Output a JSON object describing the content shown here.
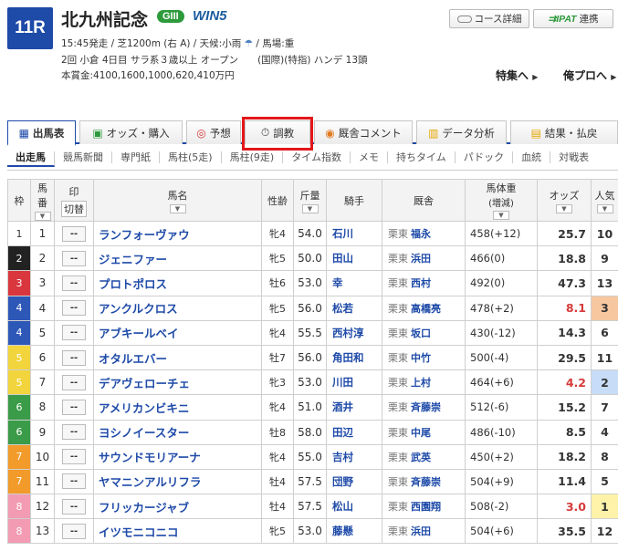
{
  "race": {
    "number": "11R",
    "title": "北九州記念",
    "grade": "GIII",
    "win5": "WIN5",
    "info_line1_pre": "15:45発走 / 芝1200m (右 A) / 天候:小雨",
    "info_line1_post": "/ 馬場:重",
    "info_line2": "2回 小倉 4日目 サラ系３歳以上 オープン　　(国際)(特指) ハンデ 13頭",
    "info_line3": "本賞金:4100,1600,1000,620,410万円",
    "weather_icon": "umbrella-icon"
  },
  "header_buttons": {
    "course": "コース詳細",
    "ipat_logo": "IPAT",
    "ipat_label": "連携",
    "special": "特集へ",
    "ore_pro": "俺プロへ"
  },
  "tabs": [
    {
      "label": "出馬表",
      "icon": "table-icon"
    },
    {
      "label": "オッズ・購入",
      "icon": "odds-icon"
    },
    {
      "label": "予想",
      "icon": "target-icon"
    },
    {
      "label": "調教",
      "icon": "stopwatch-icon"
    },
    {
      "label": "厩舎コメント",
      "icon": "comment-icon"
    },
    {
      "label": "データ分析",
      "icon": "chart-icon"
    },
    {
      "label": "結果・払戻",
      "icon": "result-icon"
    }
  ],
  "subtabs": [
    "出走馬",
    "競馬新聞",
    "専門紙",
    "馬柱(5走)",
    "馬柱(9走)",
    "タイム指数",
    "メモ",
    "持ちタイム",
    "パドック",
    "血統",
    "対戦表"
  ],
  "columns": {
    "waku": "枠",
    "umaban_1": "馬",
    "umaban_2": "番",
    "mark_1": "印",
    "mark_2": "切替",
    "name": "馬名",
    "sex": "性齢",
    "kin": "斤量",
    "jockey": "騎手",
    "stable": "厩舎",
    "weight_1": "馬体重",
    "weight_2": "(増減)",
    "odds": "オッズ",
    "pop": "人気"
  },
  "horses": [
    {
      "waku": "1",
      "num": "1",
      "mark": "--",
      "name": "ランフォーヴァウ",
      "sex": "牝4",
      "kin": "54.0",
      "jockey": "石川",
      "region": "栗東",
      "trainer": "福永",
      "weight": "458(+12)",
      "odds": "25.7",
      "pop": "10"
    },
    {
      "waku": "2",
      "num": "2",
      "mark": "--",
      "name": "ジェニファー",
      "sex": "牝5",
      "kin": "50.0",
      "jockey": "田山",
      "region": "栗東",
      "trainer": "浜田",
      "weight": "466(0)",
      "odds": "18.8",
      "pop": "9"
    },
    {
      "waku": "3",
      "num": "3",
      "mark": "--",
      "name": "プロトポロス",
      "sex": "牡6",
      "kin": "53.0",
      "jockey": "幸",
      "region": "栗東",
      "trainer": "西村",
      "weight": "492(0)",
      "odds": "47.3",
      "pop": "13"
    },
    {
      "waku": "4",
      "num": "4",
      "mark": "--",
      "name": "アンクルクロス",
      "sex": "牝5",
      "kin": "56.0",
      "jockey": "松若",
      "region": "栗東",
      "trainer": "高橋亮",
      "weight": "478(+2)",
      "odds": "8.1",
      "pop": "3"
    },
    {
      "waku": "4",
      "num": "5",
      "mark": "--",
      "name": "アブキールベイ",
      "sex": "牝4",
      "kin": "55.5",
      "jockey": "西村淳",
      "region": "栗東",
      "trainer": "坂口",
      "weight": "430(-12)",
      "odds": "14.3",
      "pop": "6"
    },
    {
      "waku": "5",
      "num": "6",
      "mark": "--",
      "name": "オタルエバー",
      "sex": "牡7",
      "kin": "56.0",
      "jockey": "角田和",
      "region": "栗東",
      "trainer": "中竹",
      "weight": "500(-4)",
      "odds": "29.5",
      "pop": "11"
    },
    {
      "waku": "5",
      "num": "7",
      "mark": "--",
      "name": "デアヴェローチェ",
      "sex": "牝3",
      "kin": "53.0",
      "jockey": "川田",
      "region": "栗東",
      "trainer": "上村",
      "weight": "464(+6)",
      "odds": "4.2",
      "pop": "2"
    },
    {
      "waku": "6",
      "num": "8",
      "mark": "--",
      "name": "アメリカンビキニ",
      "sex": "牝4",
      "kin": "51.0",
      "jockey": "酒井",
      "region": "栗東",
      "trainer": "斉藤崇",
      "weight": "512(-6)",
      "odds": "15.2",
      "pop": "7"
    },
    {
      "waku": "6",
      "num": "9",
      "mark": "--",
      "name": "ヨシノイースター",
      "sex": "牡8",
      "kin": "58.0",
      "jockey": "田辺",
      "region": "栗東",
      "trainer": "中尾",
      "weight": "486(-10)",
      "odds": "8.5",
      "pop": "4"
    },
    {
      "waku": "7",
      "num": "10",
      "mark": "--",
      "name": "サウンドモリアーナ",
      "sex": "牝4",
      "kin": "55.0",
      "jockey": "吉村",
      "region": "栗東",
      "trainer": "武英",
      "weight": "450(+2)",
      "odds": "18.2",
      "pop": "8"
    },
    {
      "waku": "7",
      "num": "11",
      "mark": "--",
      "name": "ヤマニンアルリフラ",
      "sex": "牡4",
      "kin": "57.5",
      "jockey": "団野",
      "region": "栗東",
      "trainer": "斉藤崇",
      "weight": "504(+9)",
      "odds": "11.4",
      "pop": "5"
    },
    {
      "waku": "8",
      "num": "12",
      "mark": "--",
      "name": "フリッカージャブ",
      "sex": "牡4",
      "kin": "57.5",
      "jockey": "松山",
      "region": "栗東",
      "trainer": "西園翔",
      "weight": "508(-2)",
      "odds": "3.0",
      "pop": "1"
    },
    {
      "waku": "8",
      "num": "13",
      "mark": "--",
      "name": "イツモニコニコ",
      "sex": "牝5",
      "kin": "53.0",
      "jockey": "藤懸",
      "region": "栗東",
      "trainer": "浜田",
      "weight": "504(+6)",
      "odds": "35.5",
      "pop": "12"
    }
  ],
  "colors": {
    "accent": "#1e4aa8",
    "highlight_box": "#e3171b",
    "waku": {
      "1": {
        "bg": "#ffffff",
        "fg": "#333333"
      },
      "2": {
        "bg": "#222222",
        "fg": "#ffffff"
      },
      "3": {
        "bg": "#d9363e",
        "fg": "#ffffff"
      },
      "4": {
        "bg": "#2e58b8",
        "fg": "#ffffff"
      },
      "5": {
        "bg": "#f2d53c",
        "fg": "#ffffff"
      },
      "6": {
        "bg": "#3a9b48",
        "fg": "#ffffff"
      },
      "7": {
        "bg": "#f29a2a",
        "fg": "#ffffff"
      },
      "8": {
        "bg": "#f29bb3",
        "fg": "#ffffff"
      }
    },
    "pop": {
      "1": {
        "bg": "#fdf2a8",
        "fg": "#333333"
      },
      "2": {
        "bg": "#c7dcf7",
        "fg": "#333333"
      },
      "3": {
        "bg": "#f7c7a0",
        "fg": "#333333"
      }
    },
    "odds_red": "#d63a3a"
  }
}
